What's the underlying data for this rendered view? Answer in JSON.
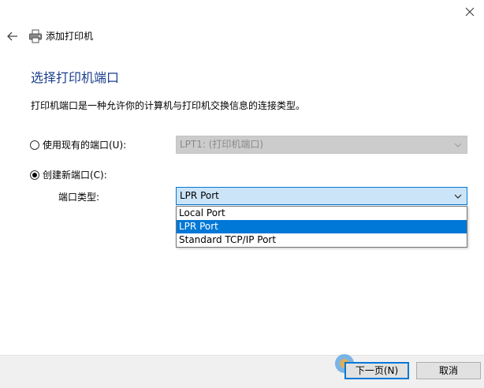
{
  "window": {
    "title": "添加打印机"
  },
  "page": {
    "heading": "选择打印机端口",
    "description": "打印机端口是一种允许你的计算机与打印机交换信息的连接类型。"
  },
  "existing_port": {
    "label": "使用现有的端口(U):",
    "selected": false,
    "value": "LPT1: (打印机端口)"
  },
  "new_port": {
    "label": "创建新端口(C):",
    "selected": true,
    "type_label": "端口类型:",
    "value": "LPR Port",
    "options": [
      "Local Port",
      "LPR Port",
      "Standard TCP/IP Port"
    ],
    "selected_option": "LPR Port"
  },
  "buttons": {
    "next": "下一页(N)",
    "cancel": "取消"
  },
  "icons": {
    "close": "close-icon",
    "back": "back-arrow-icon",
    "printer": "printer-icon",
    "chevron": "chevron-down-icon"
  },
  "colors": {
    "accent": "#0078d7",
    "heading": "#1a3e8c",
    "active_select_bg": "#cce4f7",
    "disabled_select_bg": "#cccccc",
    "footer_bg": "#f0f0f0"
  }
}
